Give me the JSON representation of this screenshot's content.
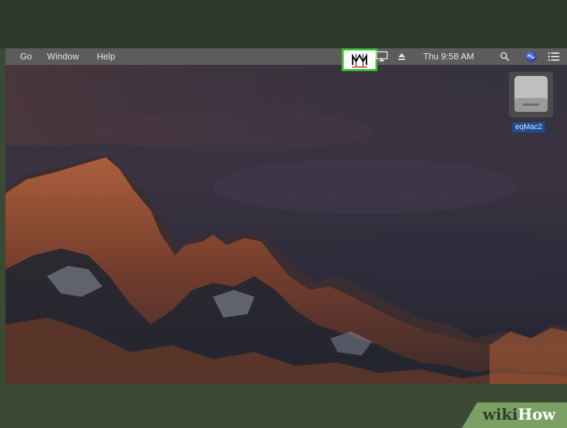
{
  "menubar": {
    "items": [
      "Go",
      "Window",
      "Help"
    ],
    "clock": "Thu 9:58 AM"
  },
  "status_icons": [
    "eqmac-icon",
    "airplay-icon",
    "eject-icon",
    "search-icon",
    "siri-icon",
    "menu-list-icon"
  ],
  "desktop": {
    "drive_label": "eqMac2"
  },
  "highlight_color": "#37c02c",
  "watermark": {
    "wiki": "wiki",
    "how": "How"
  }
}
